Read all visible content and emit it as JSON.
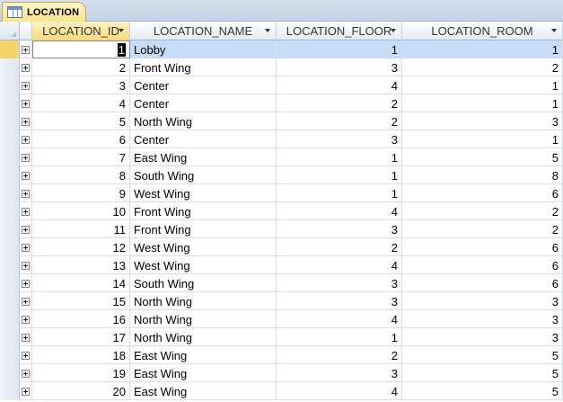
{
  "tab": {
    "label": "LOCATION",
    "icon": "table-icon"
  },
  "columns": [
    {
      "key": "id",
      "label": "LOCATION_ID"
    },
    {
      "key": "name",
      "label": "LOCATION_NAME"
    },
    {
      "key": "floor",
      "label": "LOCATION_FLOOR"
    },
    {
      "key": "room",
      "label": "LOCATION_ROOM"
    }
  ],
  "rows": [
    {
      "id": "1",
      "name": "Lobby",
      "floor": "1",
      "room": "1"
    },
    {
      "id": "2",
      "name": "Front Wing",
      "floor": "3",
      "room": "2"
    },
    {
      "id": "3",
      "name": "Center",
      "floor": "4",
      "room": "1"
    },
    {
      "id": "4",
      "name": "Center",
      "floor": "2",
      "room": "1"
    },
    {
      "id": "5",
      "name": "North Wing",
      "floor": "2",
      "room": "3"
    },
    {
      "id": "6",
      "name": "Center",
      "floor": "3",
      "room": "1"
    },
    {
      "id": "7",
      "name": "East Wing",
      "floor": "1",
      "room": "5"
    },
    {
      "id": "8",
      "name": "South Wing",
      "floor": "1",
      "room": "8"
    },
    {
      "id": "9",
      "name": "West Wing",
      "floor": "1",
      "room": "6"
    },
    {
      "id": "10",
      "name": "Front Wing",
      "floor": "4",
      "room": "2"
    },
    {
      "id": "11",
      "name": "Front Wing",
      "floor": "3",
      "room": "2"
    },
    {
      "id": "12",
      "name": "West Wing",
      "floor": "2",
      "room": "6"
    },
    {
      "id": "13",
      "name": "West Wing",
      "floor": "4",
      "room": "6"
    },
    {
      "id": "14",
      "name": "South Wing",
      "floor": "3",
      "room": "6"
    },
    {
      "id": "15",
      "name": "North Wing",
      "floor": "3",
      "room": "3"
    },
    {
      "id": "16",
      "name": "North Wing",
      "floor": "4",
      "room": "3"
    },
    {
      "id": "17",
      "name": "North Wing",
      "floor": "1",
      "room": "3"
    },
    {
      "id": "18",
      "name": "East Wing",
      "floor": "2",
      "room": "5"
    },
    {
      "id": "19",
      "name": "East Wing",
      "floor": "3",
      "room": "5"
    },
    {
      "id": "20",
      "name": "East Wing",
      "floor": "4",
      "room": "5"
    }
  ]
}
